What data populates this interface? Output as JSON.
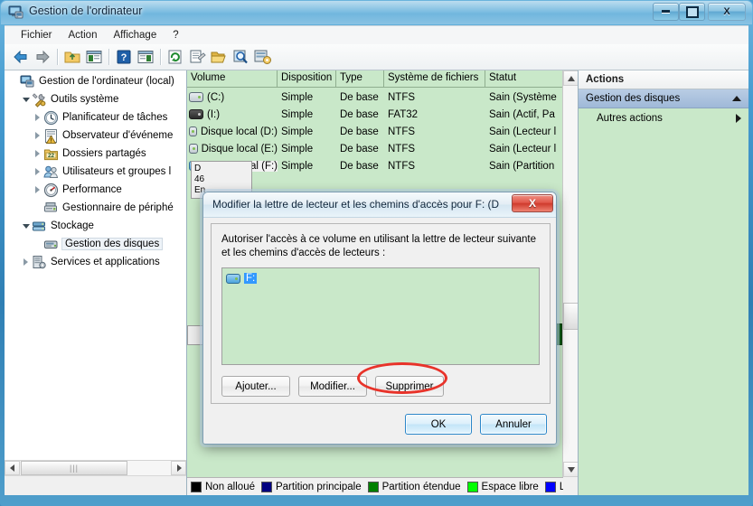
{
  "window": {
    "title": "Gestion de l'ordinateur",
    "icon": "computer-management-icon",
    "controls": {
      "minimize": "Réduire",
      "maximize": "Agrandir",
      "close": "X"
    }
  },
  "menu": {
    "items": [
      {
        "label": "Fichier",
        "name": "menu-fichier"
      },
      {
        "label": "Action",
        "name": "menu-action"
      },
      {
        "label": "Affichage",
        "name": "menu-affichage"
      },
      {
        "label": "?",
        "name": "menu-aide"
      }
    ]
  },
  "toolbar": {
    "buttons": [
      {
        "name": "back-icon",
        "glyph": "back"
      },
      {
        "name": "forward-icon",
        "glyph": "forward"
      },
      {
        "name": "up-folder-icon",
        "glyph": "folder-up"
      },
      {
        "name": "show-console-tree-icon",
        "glyph": "console-tree"
      },
      {
        "name": "help-icon",
        "glyph": "help"
      },
      {
        "name": "show-action-pane-icon",
        "glyph": "action-pane"
      },
      {
        "name": "refresh-icon",
        "glyph": "refresh"
      },
      {
        "name": "properties-icon",
        "glyph": "properties"
      },
      {
        "name": "open-icon",
        "glyph": "open-folder"
      },
      {
        "name": "rescan-disks-icon",
        "glyph": "magnifier"
      },
      {
        "name": "create-volume-icon",
        "glyph": "disk-settings"
      }
    ]
  },
  "tree": {
    "nodes": [
      {
        "label": "Gestion de l'ordinateur (local)",
        "indent": 0,
        "twisty": "none",
        "icon": "computer-icon",
        "selected": false,
        "name": "tree-item-computer-management"
      },
      {
        "label": "Outils système",
        "indent": 1,
        "twisty": "expanded",
        "icon": "tools-icon",
        "selected": false,
        "name": "tree-item-system-tools"
      },
      {
        "label": "Planificateur de tâches",
        "indent": 2,
        "twisty": "collapsed",
        "icon": "clock-icon",
        "selected": false,
        "name": "tree-item-task-scheduler"
      },
      {
        "label": "Observateur d'événeme",
        "indent": 2,
        "twisty": "collapsed",
        "icon": "event-viewer-icon",
        "selected": false,
        "name": "tree-item-event-viewer"
      },
      {
        "label": "Dossiers partagés",
        "indent": 2,
        "twisty": "collapsed",
        "icon": "shared-folders-icon",
        "selected": false,
        "name": "tree-item-shared-folders"
      },
      {
        "label": "Utilisateurs et groupes l",
        "indent": 2,
        "twisty": "collapsed",
        "icon": "users-groups-icon",
        "selected": false,
        "name": "tree-item-local-users-groups"
      },
      {
        "label": "Performance",
        "indent": 2,
        "twisty": "collapsed",
        "icon": "performance-icon",
        "selected": false,
        "name": "tree-item-performance"
      },
      {
        "label": "Gestionnaire de périphé",
        "indent": 2,
        "twisty": "none",
        "icon": "device-manager-icon",
        "selected": false,
        "name": "tree-item-device-manager"
      },
      {
        "label": "Stockage",
        "indent": 1,
        "twisty": "expanded",
        "icon": "storage-icon",
        "selected": false,
        "name": "tree-item-storage"
      },
      {
        "label": "Gestion des disques",
        "indent": 2,
        "twisty": "none",
        "icon": "disk-management-icon",
        "selected": true,
        "name": "tree-item-disk-management"
      },
      {
        "label": "Services et applications",
        "indent": 1,
        "twisty": "collapsed",
        "icon": "services-icon",
        "selected": false,
        "name": "tree-item-services-applications"
      }
    ],
    "scroll_thumb_glyph": "|||"
  },
  "volumes": {
    "columns": [
      "Volume",
      "Disposition",
      "Type",
      "Système de fichiers",
      "Statut"
    ],
    "rows": [
      {
        "volume": "(C:)",
        "icon": "drive-icon",
        "disposition": "Simple",
        "type": "De base",
        "fs": "NTFS",
        "status": "Sain (Système",
        "selected": false
      },
      {
        "volume": "(I:)",
        "icon": "drive-dark-icon",
        "disposition": "Simple",
        "type": "De base",
        "fs": "FAT32",
        "status": "Sain (Actif, Pa",
        "selected": false
      },
      {
        "volume": "Disque local (D:)",
        "icon": "drive-icon",
        "disposition": "Simple",
        "type": "De base",
        "fs": "NTFS",
        "status": "Sain (Lecteur l",
        "selected": false
      },
      {
        "volume": "Disque local (E:)",
        "icon": "drive-icon",
        "disposition": "Simple",
        "type": "De base",
        "fs": "NTFS",
        "status": "Sain (Lecteur l",
        "selected": false
      },
      {
        "volume": "Disque local (F:)",
        "icon": "drive-blue-icon",
        "disposition": "Simple",
        "type": "De base",
        "fs": "NTFS",
        "status": "Sain (Partition",
        "selected": true
      }
    ]
  },
  "disk_graphic": {
    "info_lines": [
      "D",
      "46",
      "En"
    ]
  },
  "legend": {
    "items": [
      {
        "label": "Non alloué",
        "color": "#000000",
        "name": "legend-unallocated"
      },
      {
        "label": "Partition principale",
        "color": "#000080",
        "name": "legend-primary-partition"
      },
      {
        "label": "Partition étendue",
        "color": "#008000",
        "name": "legend-extended-partition"
      },
      {
        "label": "Espace libre",
        "color": "#00ff00",
        "name": "legend-free-space"
      },
      {
        "label": "Le",
        "color": "#0000ff",
        "name": "legend-logical-drive"
      }
    ]
  },
  "actions": {
    "title": "Actions",
    "group": {
      "label": "Gestion des disques",
      "caret": "chevron-up-icon"
    },
    "items": [
      {
        "label": "Autres actions",
        "caret": "chevron-right-icon",
        "name": "action-more-actions"
      }
    ]
  },
  "dialog": {
    "title": "Modifier la lettre de lecteur et les chemins d'accès pour F: (D...",
    "close_glyph": "X",
    "description": "Autoriser l'accès à ce volume en utilisant la lettre de lecteur suivante et les chemins d'accès de lecteurs :",
    "list": [
      {
        "label": "F:",
        "icon": "drive-blue-icon",
        "selected": true,
        "name": "drive-path-list-item"
      }
    ],
    "buttons": {
      "add": "Ajouter...",
      "change": "Modifier...",
      "remove": "Supprimer",
      "ok": "OK",
      "cancel": "Annuler"
    },
    "highlight": {
      "target": "remove",
      "color": "#e8332a",
      "shape": "ellipse"
    }
  }
}
